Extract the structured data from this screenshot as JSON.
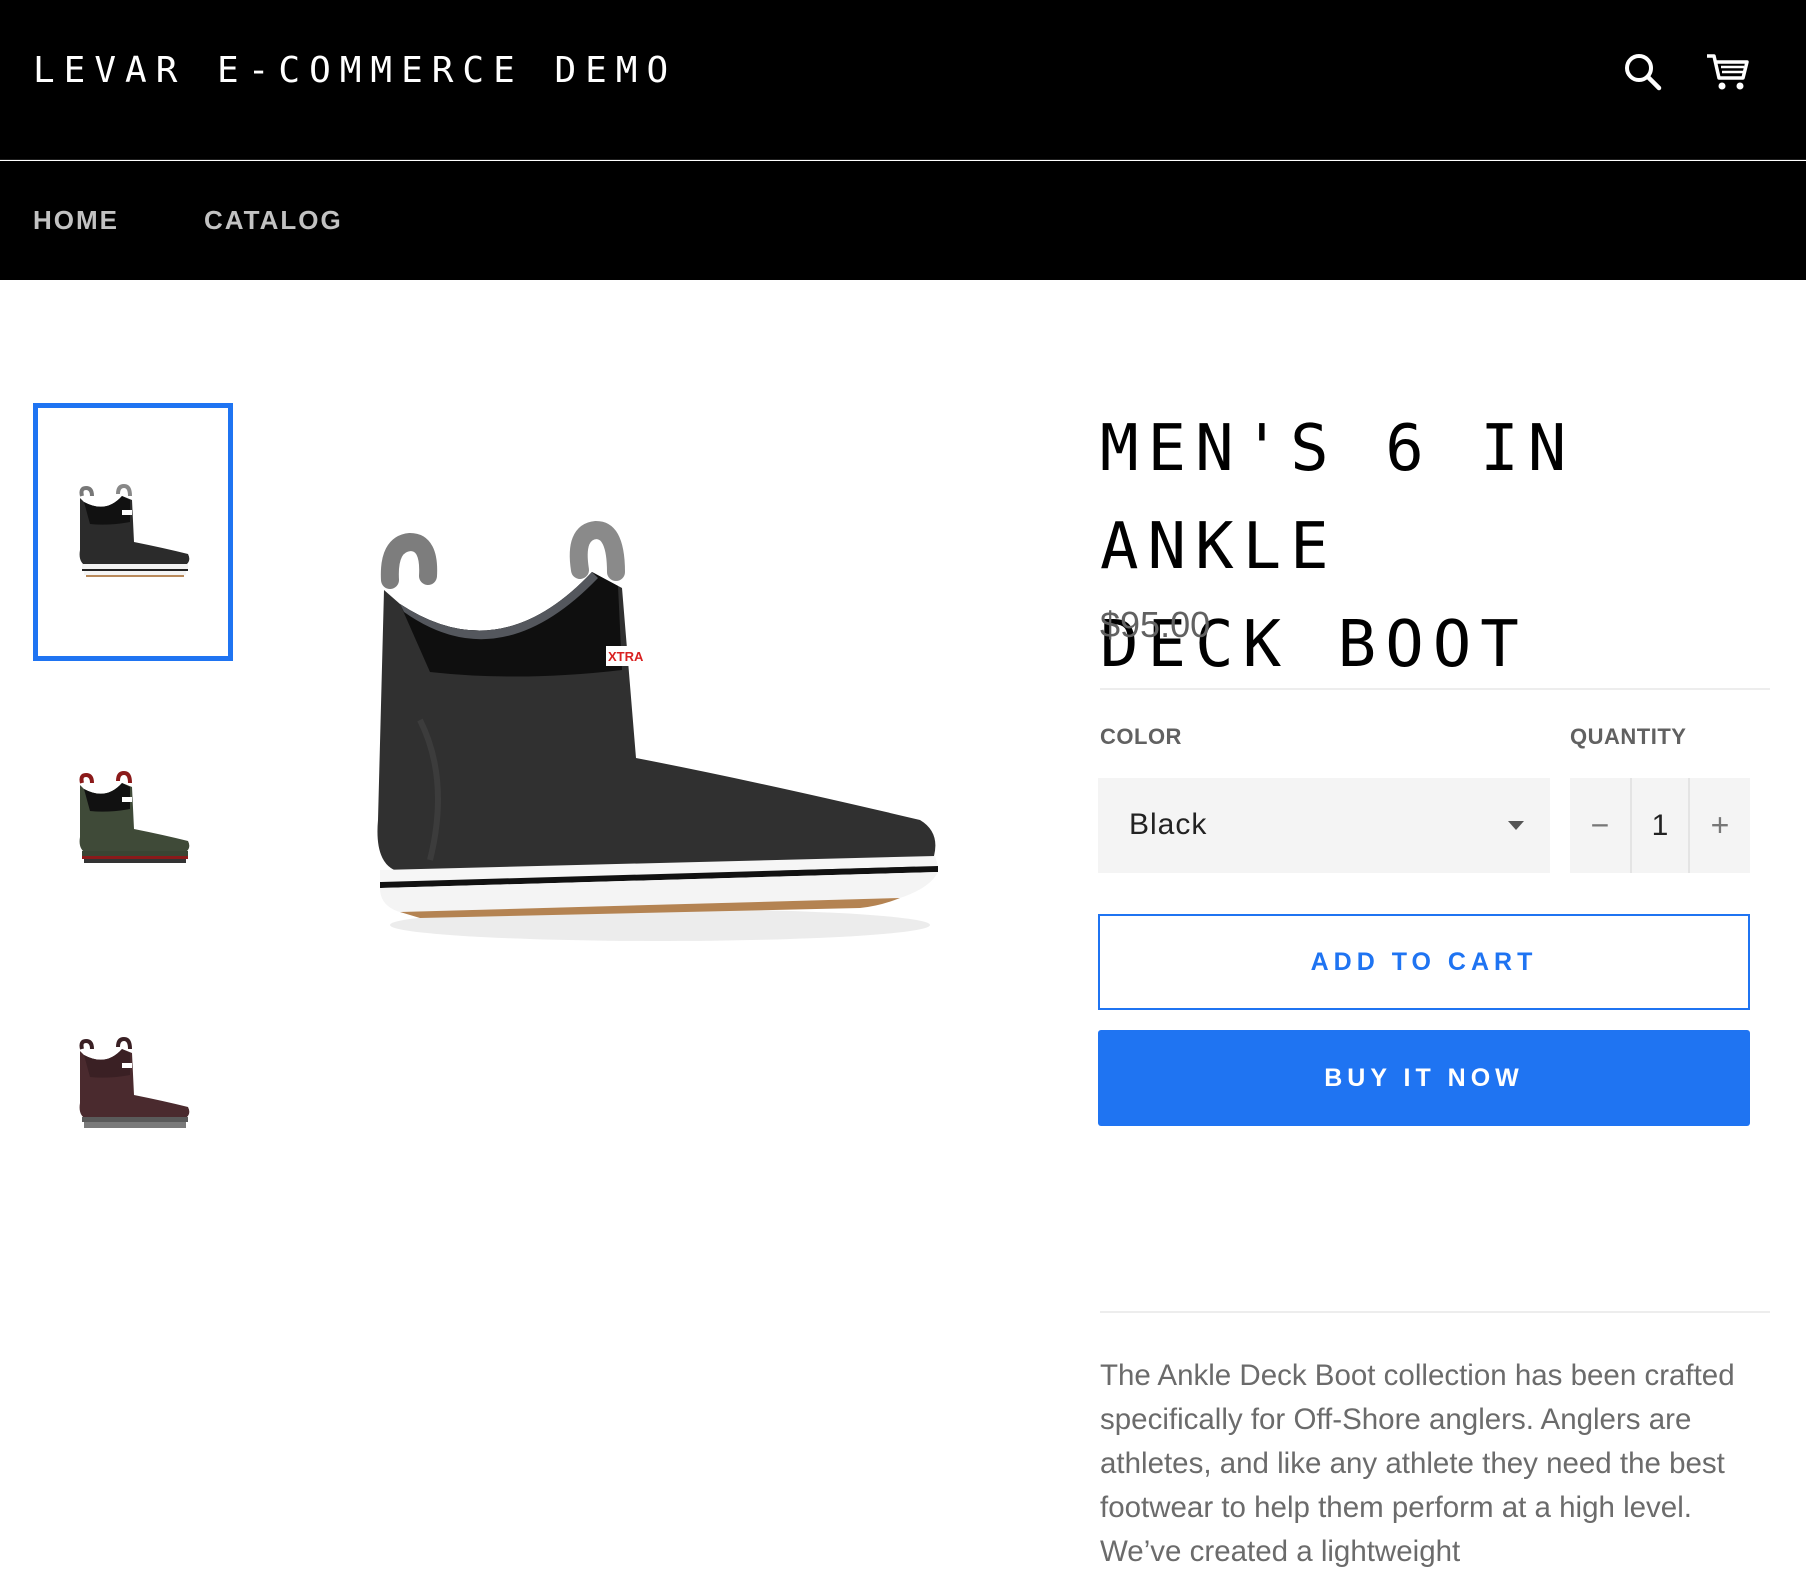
{
  "header": {
    "site_title": "LEVAR E-COMMERCE DEMO",
    "icons": [
      "search-icon",
      "cart-icon"
    ]
  },
  "nav": {
    "items": [
      {
        "label": "HOME"
      },
      {
        "label": "CATALOG"
      }
    ]
  },
  "gallery": {
    "thumbnails": [
      {
        "color_name": "black",
        "selected": true
      },
      {
        "color_name": "green",
        "selected": false
      },
      {
        "color_name": "brown",
        "selected": false
      }
    ],
    "main_image_brand_tag": "XTRA"
  },
  "product": {
    "title_line1": "MEN'S 6 IN ANKLE",
    "title_line2": "DECK BOOT",
    "price": "$95.00",
    "color_label": "COLOR",
    "color_value": "Black",
    "quantity_label": "QUANTITY",
    "quantity_minus": "−",
    "quantity_value": "1",
    "quantity_plus": "+",
    "add_to_cart": "ADD TO CART",
    "buy_now": "BUY IT NOW",
    "description": "The Ankle Deck Boot collection has been crafted specifically for Off-Shore anglers. Anglers are athletes, and like any athlete they need the best footwear to help them perform at a high level. We’ve created a lightweight"
  },
  "colors": {
    "accent": "#1f74f2",
    "header_bg": "#000000",
    "nav_text": "#c2c2c2",
    "price_text": "#616161",
    "input_bg": "#f4f4f4"
  }
}
